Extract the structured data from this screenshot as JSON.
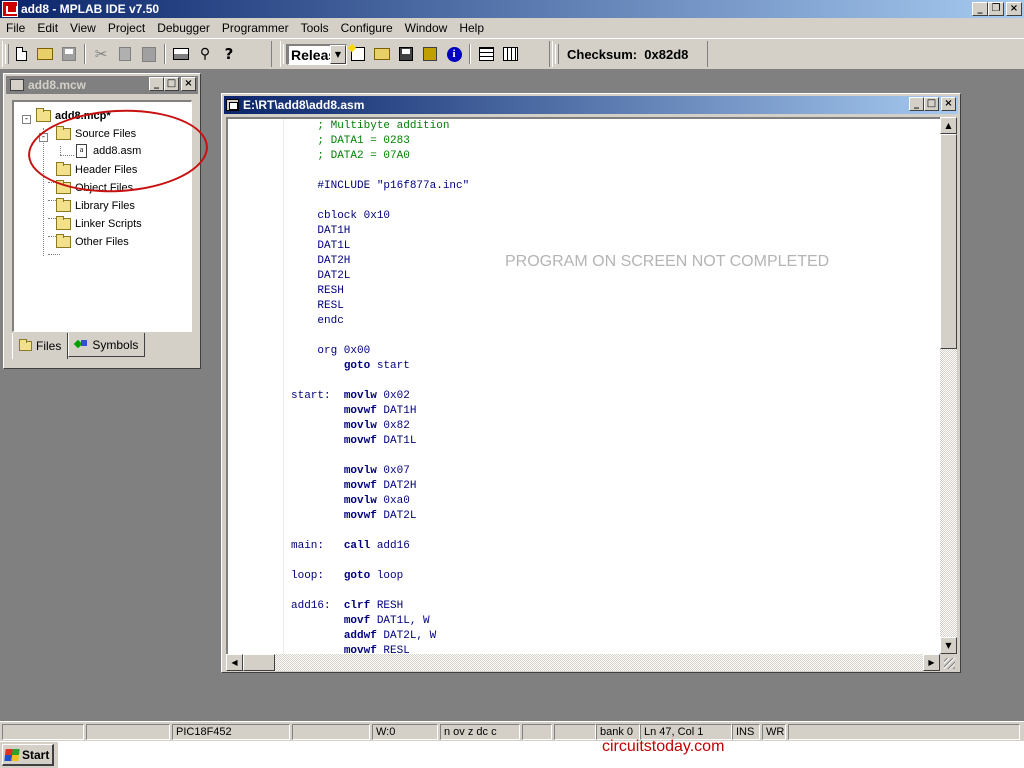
{
  "app": {
    "title": "add8 - MPLAB IDE v7.50",
    "window_buttons": [
      "_",
      "❐",
      "×"
    ]
  },
  "menu": [
    "File",
    "Edit",
    "View",
    "Project",
    "Debugger",
    "Programmer",
    "Tools",
    "Configure",
    "Window",
    "Help"
  ],
  "toolbar": {
    "build_config": "Release",
    "checksum": "Checksum:  0x82d8",
    "icons": [
      "new-file-icon",
      "open-icon",
      "save-icon",
      "cut-icon",
      "copy-icon",
      "paste-icon",
      "print-icon",
      "find-icon",
      "help-icon",
      "new-project-icon",
      "open-project-icon",
      "save-project-icon",
      "chip-icon",
      "info-icon",
      "build-icon",
      "make-icon"
    ]
  },
  "project_window": {
    "title": "add8.mcw",
    "tree": {
      "root": "add8.mcp*",
      "source_files": "Source Files",
      "asm_file": "add8.asm",
      "header_files": "Header Files",
      "object_files": "Object Files",
      "library_files": "Library Files",
      "linker_scripts": "Linker Scripts",
      "other_files": "Other Files"
    },
    "tabs": {
      "files": "Files",
      "symbols": "Symbols"
    }
  },
  "editor": {
    "title": "E:\\RT\\add8\\add8.asm",
    "watermark": "PROGRAM ON SCREEN NOT COMPLETED",
    "lines": [
      {
        "label": "",
        "op": "",
        "arg": "",
        "comment": "; Multibyte addition"
      },
      {
        "label": "",
        "op": "",
        "arg": "",
        "comment": "; DATA1 = 0283"
      },
      {
        "label": "",
        "op": "",
        "arg": "",
        "comment": "; DATA2 = 07A0"
      },
      {
        "label": "",
        "op": "",
        "arg": "",
        "comment": ""
      },
      {
        "label": "",
        "op": "",
        "arg": "#INCLUDE \"p16f877a.inc\"",
        "comment": ""
      },
      {
        "label": "",
        "op": "",
        "arg": "",
        "comment": ""
      },
      {
        "label": "",
        "op": "",
        "arg": "cblock 0x10",
        "comment": ""
      },
      {
        "label": "",
        "op": "",
        "arg": "DAT1H",
        "comment": ""
      },
      {
        "label": "",
        "op": "",
        "arg": "DAT1L",
        "comment": ""
      },
      {
        "label": "",
        "op": "",
        "arg": "DAT2H",
        "comment": ""
      },
      {
        "label": "",
        "op": "",
        "arg": "DAT2L",
        "comment": ""
      },
      {
        "label": "",
        "op": "",
        "arg": "RESH",
        "comment": ""
      },
      {
        "label": "",
        "op": "",
        "arg": "RESL",
        "comment": ""
      },
      {
        "label": "",
        "op": "",
        "arg": "endc",
        "comment": ""
      },
      {
        "label": "",
        "op": "",
        "arg": "",
        "comment": ""
      },
      {
        "label": "",
        "op": "",
        "arg": "org 0x00",
        "comment": ""
      },
      {
        "label": "",
        "op": "goto",
        "arg": " start",
        "comment": ""
      },
      {
        "label": "",
        "op": "",
        "arg": "",
        "comment": ""
      },
      {
        "label": "start:",
        "op": "movlw",
        "arg": " 0x02",
        "comment": ""
      },
      {
        "label": "",
        "op": "movwf",
        "arg": " DAT1H",
        "comment": ""
      },
      {
        "label": "",
        "op": "movlw",
        "arg": " 0x82",
        "comment": ""
      },
      {
        "label": "",
        "op": "movwf",
        "arg": " DAT1L",
        "comment": ""
      },
      {
        "label": "",
        "op": "",
        "arg": "",
        "comment": ""
      },
      {
        "label": "",
        "op": "movlw",
        "arg": " 0x07",
        "comment": ""
      },
      {
        "label": "",
        "op": "movwf",
        "arg": " DAT2H",
        "comment": ""
      },
      {
        "label": "",
        "op": "movlw",
        "arg": " 0xa0",
        "comment": ""
      },
      {
        "label": "",
        "op": "movwf",
        "arg": " DAT2L",
        "comment": ""
      },
      {
        "label": "",
        "op": "",
        "arg": "",
        "comment": ""
      },
      {
        "label": "main:",
        "op": "call",
        "arg": " add16",
        "comment": ""
      },
      {
        "label": "",
        "op": "",
        "arg": "",
        "comment": ""
      },
      {
        "label": "loop:",
        "op": "goto",
        "arg": " loop",
        "comment": ""
      },
      {
        "label": "",
        "op": "",
        "arg": "",
        "comment": ""
      },
      {
        "label": "add16:",
        "op": "clrf",
        "arg": " RESH",
        "comment": ""
      },
      {
        "label": "",
        "op": "movf",
        "arg": " DAT1L, W",
        "comment": ""
      },
      {
        "label": "",
        "op": "addwf",
        "arg": " DAT2L, W",
        "comment": ""
      },
      {
        "label": "",
        "op": "movwf",
        "arg": " RESL",
        "comment": ""
      }
    ]
  },
  "statusbar": {
    "device": "PIC18F452",
    "w_reg": "W:0",
    "flags": "n ov z dc c",
    "bank": "bank 0",
    "position": "Ln 47, Col 1",
    "ins": "INS",
    "wr": "WR"
  },
  "taskbar": {
    "start": "Start"
  },
  "credit": "circuitstoday.com"
}
